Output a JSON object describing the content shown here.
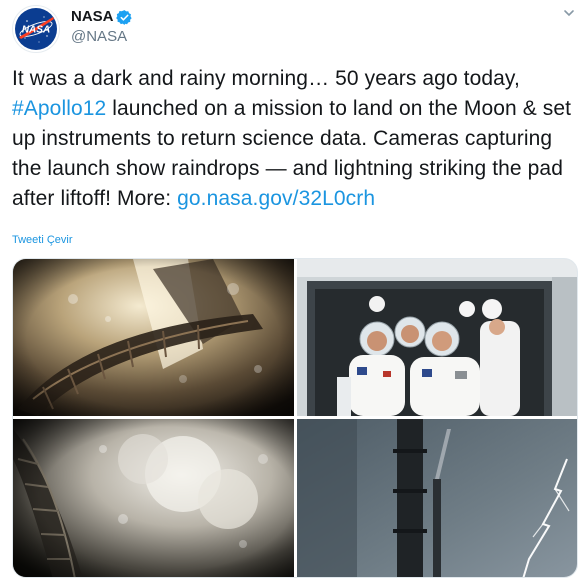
{
  "account": {
    "name": "NASA",
    "handle": "@NASA",
    "verified": true,
    "avatar_icon": "nasa-meatball-logo",
    "avatar_logo_text": "NASA"
  },
  "tweet": {
    "text_before_hashtag": "It was a dark and rainy morning… 50 years ago today, ",
    "hashtag": "#Apollo12",
    "text_after_hashtag": " launched on a mission to land on the Moon & set up instruments to return science data. Cameras capturing the launch show raindrops — and lightning striking the pad after liftoff! More: ",
    "link": "go.nasa.gov/32L0crh",
    "translate_label": "Tweeti Çevir"
  },
  "media": {
    "photos": [
      {
        "subject": "launch-tower-raindrops-photo"
      },
      {
        "subject": "astronauts-walkout-photo"
      },
      {
        "subject": "launch-smoke-raindrops-photo"
      },
      {
        "subject": "lightning-strike-photo"
      }
    ]
  },
  "colors": {
    "text": "#14171a",
    "secondary": "#657786",
    "link": "#1b95e0",
    "verified": "#1da1f2",
    "nasa_blue": "#0b3d91",
    "nasa_red": "#fc3d21"
  }
}
